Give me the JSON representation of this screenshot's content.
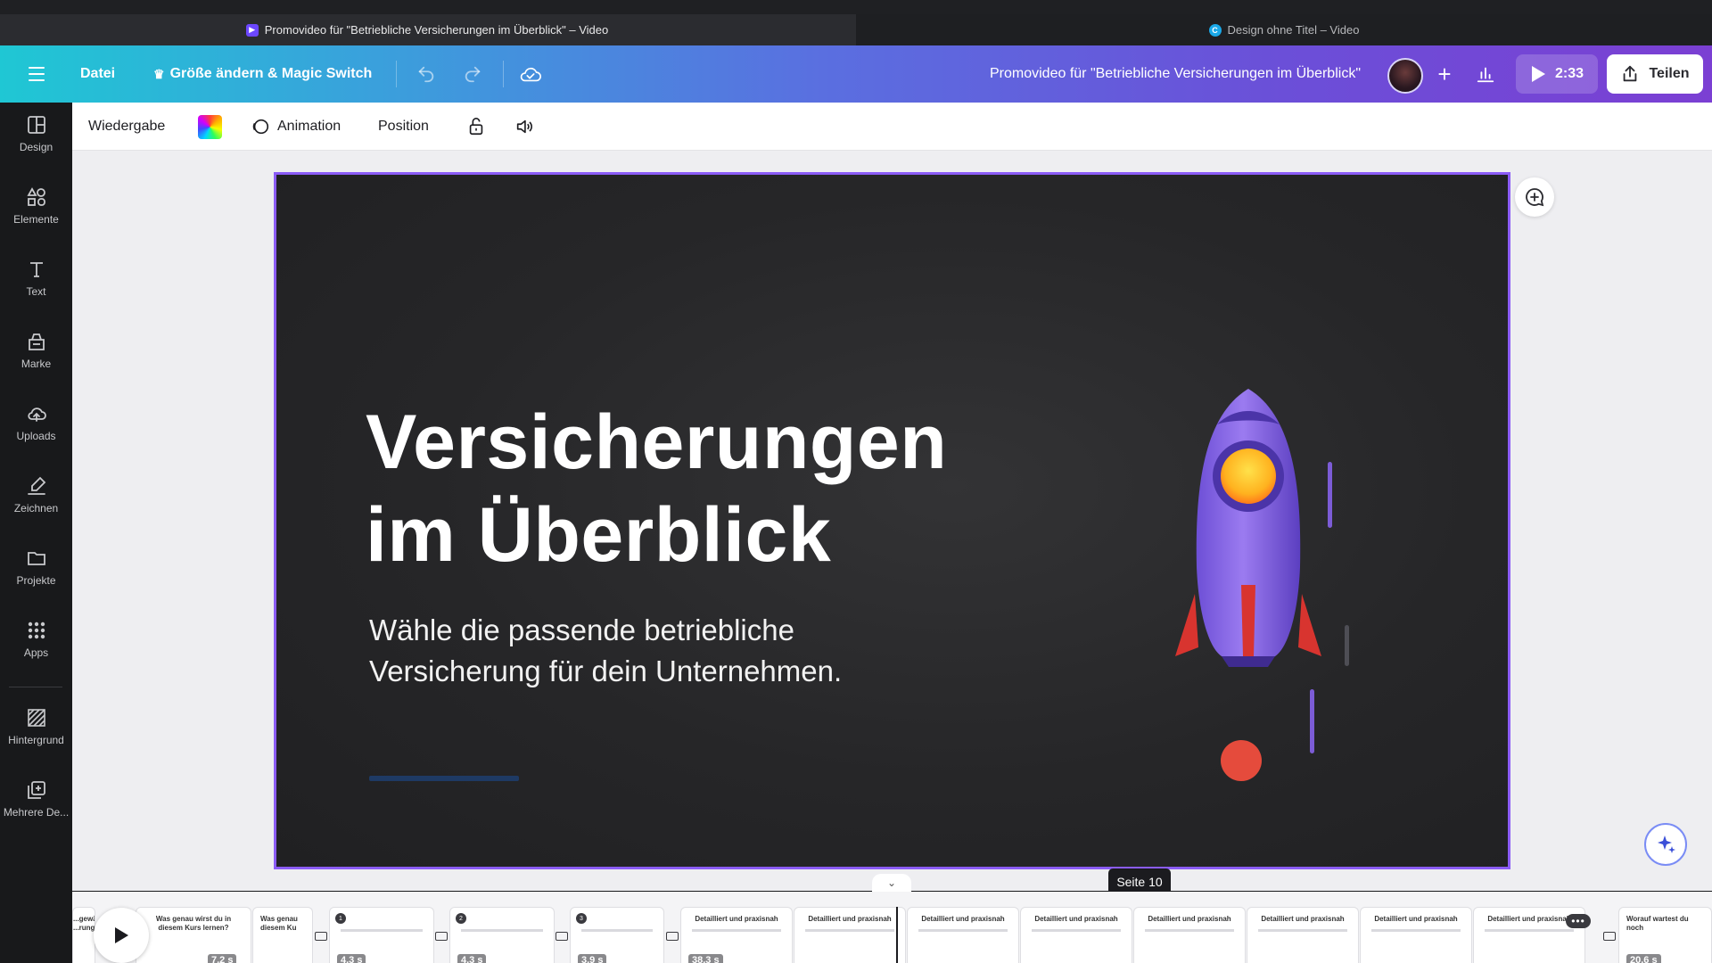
{
  "browser": {
    "active_tab": "Promovideo für \"Betriebliche Versicherungen im Überblick\" – Video",
    "inactive_tab": "Design ohne Titel – Video"
  },
  "header": {
    "file_label": "Datei",
    "magic_label": "Größe ändern & Magic Switch",
    "document_title": "Promovideo für \"Betriebliche Versicherungen im Überblick\"",
    "play_duration": "2:33",
    "share_label": "Teilen"
  },
  "sidebar": {
    "items": [
      {
        "label": "Design",
        "icon": "design-icon"
      },
      {
        "label": "Elemente",
        "icon": "elements-icon"
      },
      {
        "label": "Text",
        "icon": "text-icon"
      },
      {
        "label": "Marke",
        "icon": "brand-icon"
      },
      {
        "label": "Uploads",
        "icon": "upload-icon"
      },
      {
        "label": "Zeichnen",
        "icon": "draw-icon"
      },
      {
        "label": "Projekte",
        "icon": "folder-icon"
      },
      {
        "label": "Apps",
        "icon": "apps-icon"
      },
      {
        "label": "Hintergrund",
        "icon": "background-icon"
      },
      {
        "label": "Mehrere De...",
        "icon": "multiple-designs-icon"
      }
    ]
  },
  "toolbar": {
    "playback_label": "Wiedergabe",
    "animation_label": "Animation",
    "position_label": "Position"
  },
  "slide": {
    "title_line1": "Versicherungen",
    "title_line2": "im Überblick",
    "subtitle_line1": "Wähle die passende betriebliche",
    "subtitle_line2": "Versicherung für dein Unternehmen."
  },
  "tooltip": "Seite 10",
  "timeline": {
    "thumbs": [
      {
        "text": "...gewählt ...rung",
        "duration": ""
      },
      {
        "text": "Was genau wirst du in diesem Kurs lernen?",
        "duration": "7,2 s"
      },
      {
        "text": "Was genau diesem Ku",
        "duration": ""
      },
      {
        "text": "",
        "duration": "4,3 s",
        "num": "1"
      },
      {
        "text": "",
        "duration": "4,3 s",
        "num": "2"
      },
      {
        "text": "",
        "duration": "3,9 s",
        "num": "3"
      },
      {
        "text": "Detailliert und praxisnah",
        "duration": "38,3 s"
      },
      {
        "text": "Detailliert und praxisnah",
        "duration": ""
      },
      {
        "text": "Detailliert und praxisnah",
        "duration": ""
      },
      {
        "text": "Detailliert und praxisnah",
        "duration": ""
      },
      {
        "text": "Detailliert und praxisnah",
        "duration": ""
      },
      {
        "text": "Detailliert und praxisnah",
        "duration": ""
      },
      {
        "text": "Detailliert und praxisnah",
        "duration": ""
      },
      {
        "text": "Detailliert und praxisnah",
        "duration": ""
      },
      {
        "text": "Worauf wartest du noch",
        "duration": "20,6 s"
      }
    ]
  },
  "colors": {
    "accent": "#8b5cf6",
    "header_start": "#1fc7d4",
    "header_end": "#7b3fd3",
    "slide_bg": "#262628"
  }
}
